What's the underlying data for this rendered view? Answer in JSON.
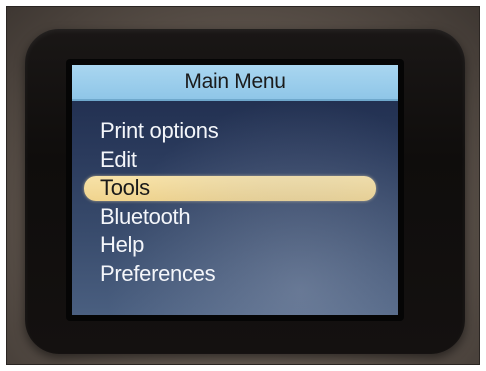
{
  "screen": {
    "title": "Main Menu",
    "menu_items": [
      {
        "label": "Print options",
        "selected": false
      },
      {
        "label": "Edit",
        "selected": false
      },
      {
        "label": "Tools",
        "selected": true
      },
      {
        "label": "Bluetooth",
        "selected": false
      },
      {
        "label": "Help",
        "selected": false
      },
      {
        "label": "Preferences",
        "selected": false
      }
    ]
  },
  "colors": {
    "title_bar": "#9fd0ee",
    "screen_background": "#2a3a5c",
    "highlight": "#f3d998",
    "menu_text": "#f4f6fa"
  }
}
